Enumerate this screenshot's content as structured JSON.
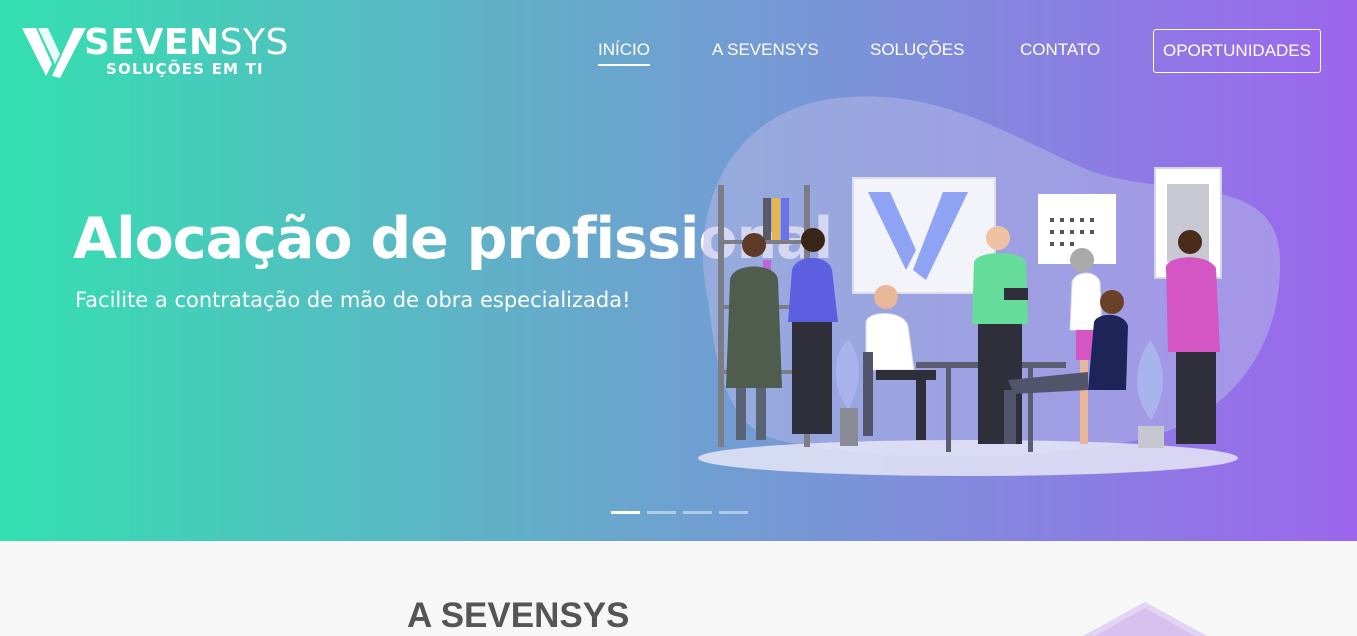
{
  "brand": {
    "name_bold": "SEVEN",
    "name_light": "SYS",
    "tagline": "SOLUÇÕES EM TI"
  },
  "nav": {
    "items": [
      {
        "label": "INÍCIO",
        "active": true
      },
      {
        "label": "A SEVENSYS",
        "active": false
      },
      {
        "label": "SOLUÇÕES",
        "active": false
      },
      {
        "label": "CONTATO",
        "active": false
      }
    ],
    "cta_label": "OPORTUNIDADES"
  },
  "hero": {
    "title": "Alocação de profissional",
    "subtitle": "Facilite a contratação de mão de obra especializada!",
    "illustration_icon": "team-meeting-illustration",
    "slides_total": 4,
    "active_slide": 1
  },
  "section": {
    "title": "A SEVENSYS"
  },
  "colors": {
    "gradient_start": "#33e0b0",
    "gradient_end": "#9c66ee",
    "section_bg": "#f7f7f7",
    "text_dark": "#555555"
  }
}
